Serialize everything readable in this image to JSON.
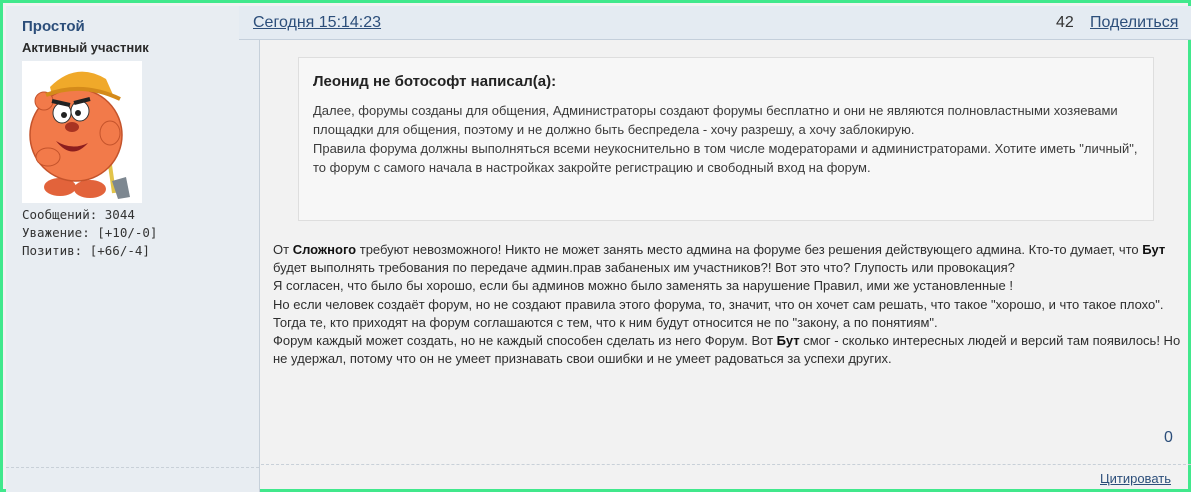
{
  "author": {
    "name": "Простой",
    "title": "Активный участник",
    "stats": {
      "posts": "Сообщений: 3044",
      "respect": "Уважение: [+10/-0]",
      "positive": "Позитив: [+66/-4]"
    }
  },
  "post": {
    "date": "Сегодня 15:14:23",
    "number": "42",
    "share_label": "Поделиться",
    "quote": {
      "title": "Леонид не ботософт написал(а):",
      "paragraph1": "Далее, форумы созданы для общения, Администраторы создают форумы бесплатно и они не являются полновластными хозяевами площадки для общения, поэтому и не должно быть беспредела - хочу разрешу, а хочу заблокирую.",
      "paragraph2": "Правила форума должны выполняться всеми неукоснительно в том числе модераторами и администраторами. Хотите иметь \"личный\", то форум с самого начала в настройках закройте регистрацию и свободный вход на форум."
    },
    "body": {
      "l1_pre": "От ",
      "l1_bold": "Сложного",
      "l1_post": " требуют невозможного!  Никто не может занять место админа на форуме без решения действующего админа. Кто-то думает, что ",
      "l1_bold2": "Бут",
      "l1_post2": " будет выполнять требования по передаче админ.прав забаненых им участников?!   Вот это что? Глупость  или провокация?",
      "l2": "Я согласен, что было бы хорошо, если бы админов можно было заменять за нарушение Правил, ими же установленные !",
      "l3": "Но если человек создаёт форум, но не создают правила этого форума, то, значит, что он хочет сам решать, что такое \"хорошо, и что такое плохо\".",
      "l4": "Тогда те, кто приходят на форум соглашаются с тем, что к ним будут относится не по \"закону, а по понятиям\".",
      "l5_pre": "Форум каждый может создать, но не каждый способен сделать из него Форум. Вот ",
      "l5_bold": "Бут",
      "l5_post": " смог - сколько интересных людей и версий там появилось! Но не удержал, потому что он не умеет признавать свои ошибки и не умеет радоваться за успехи других."
    },
    "likes": "0",
    "quote_label": "Цитировать"
  }
}
